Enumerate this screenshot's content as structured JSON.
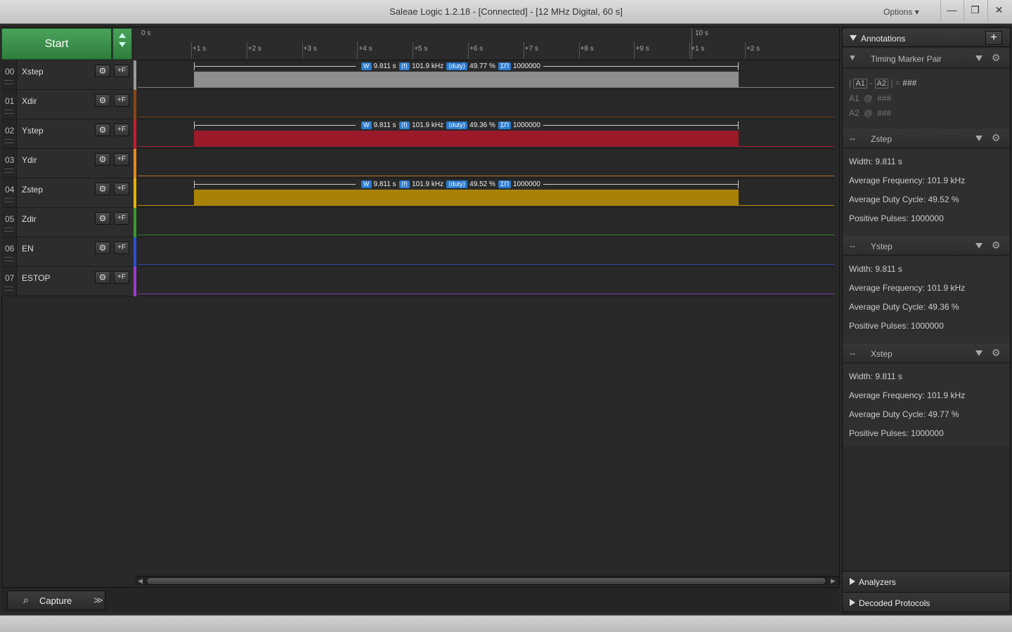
{
  "window": {
    "title": "Saleae Logic 1.2.18 - [Connected] - [12 MHz Digital, 60 s]",
    "options_label": "Options",
    "minimize_glyph": "—",
    "restore_glyph": "❐",
    "close_glyph": "✕"
  },
  "toolbar": {
    "start_label": "Start"
  },
  "channels": [
    {
      "num": "00",
      "name": "Xstep",
      "color": "#9a9a9a"
    },
    {
      "num": "01",
      "name": "Xdir",
      "color": "#8b4513"
    },
    {
      "num": "02",
      "name": "Ystep",
      "color": "#c41e2e"
    },
    {
      "num": "03",
      "name": "Ydir",
      "color": "#e08a1e"
    },
    {
      "num": "04",
      "name": "Zstep",
      "color": "#e3b200"
    },
    {
      "num": "05",
      "name": "Zdir",
      "color": "#3a9a2a"
    },
    {
      "num": "06",
      "name": "EN",
      "color": "#2a4fd0"
    },
    {
      "num": "07",
      "name": "ESTOP",
      "color": "#9a3ad0"
    }
  ],
  "channel_buttons": {
    "settings_glyph": "⚙",
    "trigger_glyph": "+F"
  },
  "ruler": {
    "major": [
      "0 s",
      "10 s"
    ],
    "minor": [
      "+1 s",
      "+2 s",
      "+3 s",
      "+4 s",
      "+5 s",
      "+6 s",
      "+7 s",
      "+8 s",
      "+9 s",
      "+1 s",
      "+2 s"
    ]
  },
  "measurements": [
    {
      "channel": "Xstep",
      "width": "9.811 s",
      "freq": "101.9 kHz",
      "duty": "49.77 %",
      "pulses": "1000000",
      "pulse_color": "#8e8e8e"
    },
    {
      "channel": "Ystep",
      "width": "9.811 s",
      "freq": "101.9 kHz",
      "duty": "49.36 %",
      "pulses": "1000000",
      "pulse_color": "#9b1a2a"
    },
    {
      "channel": "Zstep",
      "width": "9.811 s",
      "freq": "101.9 kHz",
      "duty": "49.52 %",
      "pulses": "1000000",
      "pulse_color": "#a88206"
    }
  ],
  "meas_tags": {
    "w": "W",
    "f": "⟨f⟩",
    "duty": "⟨duty⟩",
    "sum": "ΣΠ"
  },
  "bottom": {
    "capture_tab": "Capture",
    "capture_icon": "⌕",
    "more_glyph": "≫"
  },
  "annotations": {
    "header": "Annotations",
    "add_glyph": "+",
    "timing_pair": {
      "label": "Timing Marker Pair",
      "formula_a1": "A1",
      "formula_a2": "A2",
      "formula_result": "###",
      "a1_label": "A1",
      "a1_at": "@",
      "a1_value": "###",
      "a2_label": "A2",
      "a2_at": "@",
      "a2_value": "###"
    },
    "items": [
      {
        "name": "Zstep",
        "width": "Width: 9.811 s",
        "freq": "Average Frequency: 101.9 kHz",
        "duty": "Average Duty Cycle: 49.52 %",
        "pulses": "Positive Pulses: 1000000"
      },
      {
        "name": "Ystep",
        "width": "Width: 9.811 s",
        "freq": "Average Frequency: 101.9 kHz",
        "duty": "Average Duty Cycle: 49.36 %",
        "pulses": "Positive Pulses: 1000000"
      },
      {
        "name": "Xstep",
        "width": "Width: 9.811 s",
        "freq": "Average Frequency: 101.9 kHz",
        "duty": "Average Duty Cycle: 49.77 %",
        "pulses": "Positive Pulses: 1000000"
      }
    ]
  },
  "analyzers": {
    "label": "Analyzers"
  },
  "decoded": {
    "label": "Decoded Protocols"
  }
}
